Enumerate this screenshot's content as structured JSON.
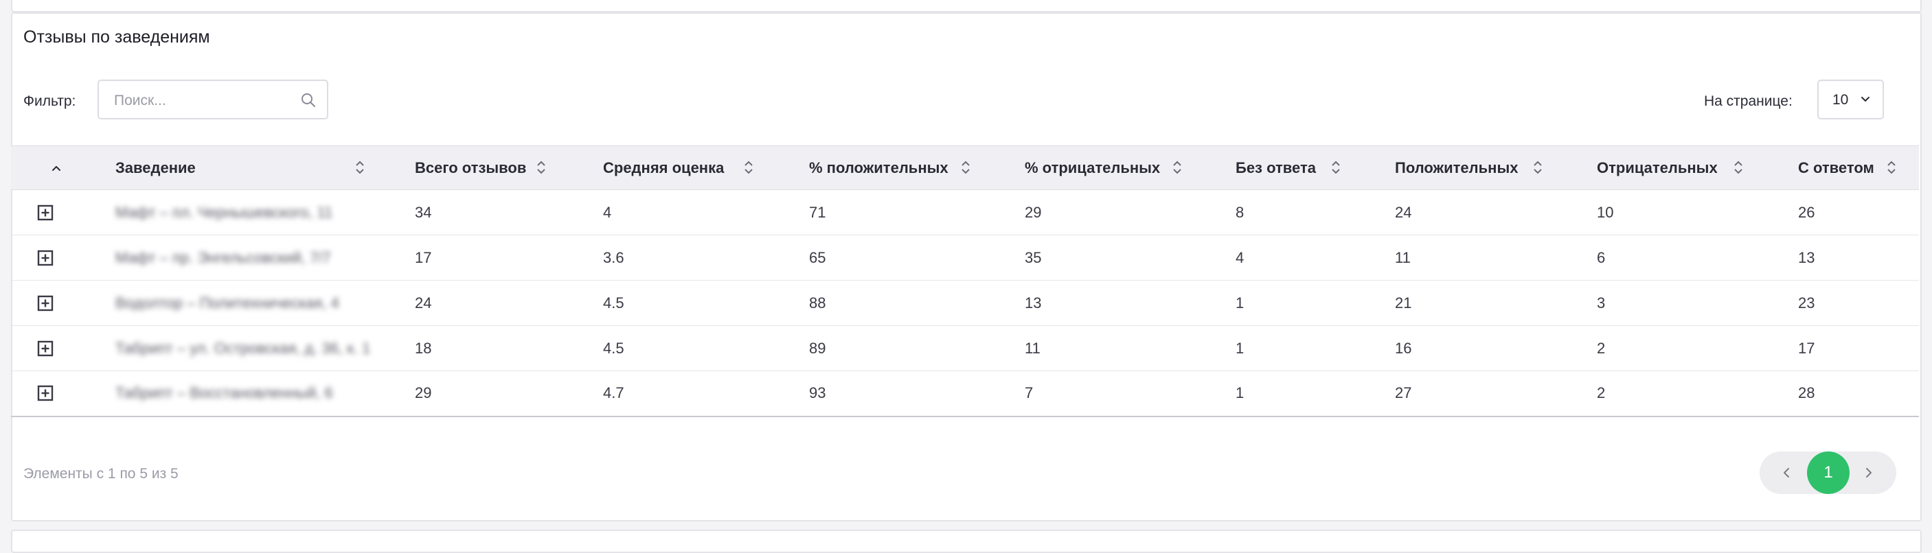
{
  "section_title": "Отзывы по заведениям",
  "filter": {
    "label": "Фильтр:",
    "placeholder": "Поиск...",
    "value": ""
  },
  "per_page": {
    "label": "На странице:",
    "value": "10"
  },
  "columns": [
    "Заведение",
    "Всего отзывов",
    "Средняя оценка",
    "% положительных",
    "% отрицательных",
    "Без ответа",
    "Положительных",
    "Отрицательных",
    "С ответом"
  ],
  "rows": [
    {
      "name": "Мафт – пл. Чернышевского, 11",
      "total": "34",
      "avg": "4",
      "pos_pct": "71",
      "neg_pct": "29",
      "no_reply": "8",
      "positive": "24",
      "negative": "10",
      "replied": "26"
    },
    {
      "name": "Мафт – пр. Энгельсовский, 7/7",
      "total": "17",
      "avg": "3.6",
      "pos_pct": "65",
      "neg_pct": "35",
      "no_reply": "4",
      "positive": "11",
      "negative": "6",
      "replied": "13"
    },
    {
      "name": "Водолтор – Политехническая, 4",
      "total": "24",
      "avg": "4.5",
      "pos_pct": "88",
      "neg_pct": "13",
      "no_reply": "1",
      "positive": "21",
      "negative": "3",
      "replied": "23"
    },
    {
      "name": "Табрипт – ул. Островская, д. 36, к. 1",
      "total": "18",
      "avg": "4.5",
      "pos_pct": "89",
      "neg_pct": "11",
      "no_reply": "1",
      "positive": "16",
      "negative": "2",
      "replied": "17"
    },
    {
      "name": "Табрипт – Восстановленный, 6",
      "total": "29",
      "avg": "4.7",
      "pos_pct": "93",
      "neg_pct": "7",
      "no_reply": "1",
      "positive": "27",
      "negative": "2",
      "replied": "28"
    }
  ],
  "footer": {
    "info": "Элементы с 1 по 5 из 5",
    "current_page": "1"
  },
  "colors": {
    "accent": "#2fc06a",
    "header_bg": "#f0f0f4",
    "border": "#dcdce2"
  }
}
